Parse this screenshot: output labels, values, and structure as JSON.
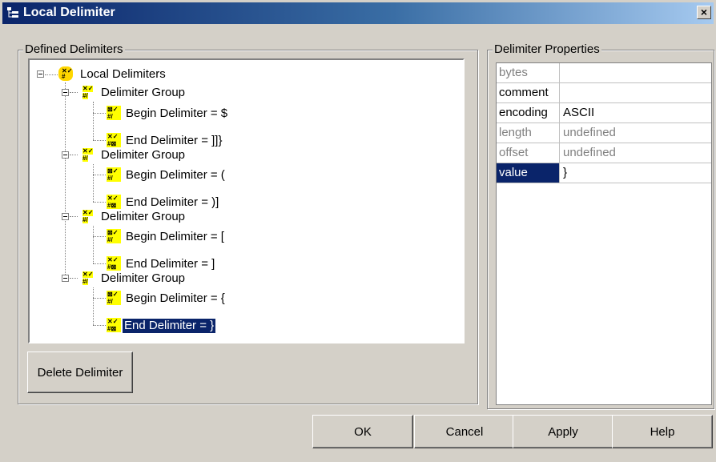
{
  "window": {
    "title": "Local Delimiter",
    "close_glyph": "×"
  },
  "defined": {
    "group_label": "Defined Delimiters",
    "tree": {
      "root": "Local Delimiters",
      "groups": [
        {
          "label": "Delimiter Group",
          "begin": "Begin Delimiter = $",
          "end": "End Delimiter = ]]}"
        },
        {
          "label": "Delimiter Group",
          "begin": "Begin Delimiter = (",
          "end": "End Delimiter = )]"
        },
        {
          "label": "Delimiter Group",
          "begin": "Begin Delimiter = [",
          "end": "End Delimiter = ]"
        },
        {
          "label": "Delimiter Group",
          "begin": "Begin Delimiter = {",
          "end": "End Delimiter = }"
        }
      ]
    },
    "delete_label": "Delete Delimiter"
  },
  "properties": {
    "group_label": "Delimiter Properties",
    "rows": [
      {
        "key": "bytes",
        "value": ""
      },
      {
        "key": "comment",
        "value": ""
      },
      {
        "key": "encoding",
        "value": "ASCII"
      },
      {
        "key": "length",
        "value": "undefined"
      },
      {
        "key": "offset",
        "value": "undefined"
      },
      {
        "key": "value",
        "value": "}"
      }
    ]
  },
  "footer": {
    "ok": "OK",
    "cancel": "Cancel",
    "apply": "Apply",
    "help": "Help"
  },
  "colors": {
    "selection": "#0a246a",
    "titlebar_start": "#0a246a",
    "node_icon": "#ffff00"
  }
}
